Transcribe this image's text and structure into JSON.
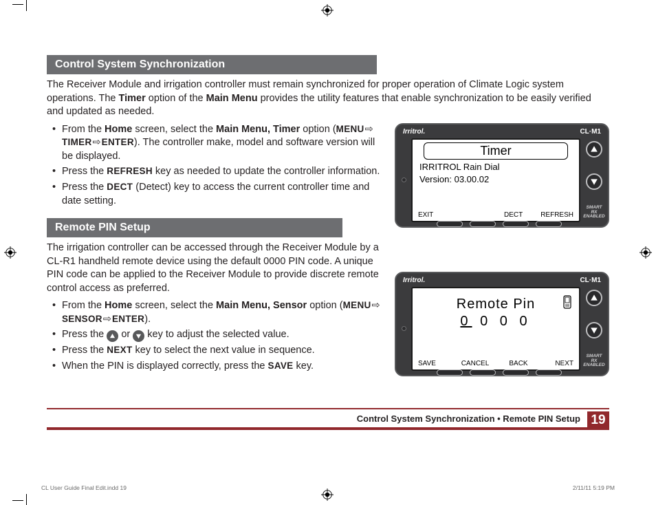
{
  "section1": {
    "title": "Control System Synchronization",
    "intro_parts": [
      "The Receiver Module and irrigation controller must remain synchronized for proper operation of Climate Logic system operations. The ",
      "Timer",
      " option of the ",
      "Main Menu",
      " provides the utility features that enable synchronization to be easily verified and updated as needed."
    ],
    "bullets": [
      {
        "pre": "From the ",
        "b1": "Home",
        "mid1": " screen, select the ",
        "b2": "Main Menu, Timer",
        "mid2": " option (",
        "path1": "MENU",
        "path2": "TIMER",
        "path3": "ENTER",
        "post": "). The controller make, model and software version will be displayed."
      },
      {
        "pre": "Press the ",
        "sc": "REFRESH",
        "post": " key as needed to update the controller information."
      },
      {
        "pre": "Press the ",
        "sc": "DECT",
        "mid": " (Detect) key to access the current controller time and date setting.",
        "post": ""
      }
    ]
  },
  "section2": {
    "title": "Remote PIN Setup",
    "intro": "The irrigation controller can be accessed through the Receiver Module by a CL-R1 handheld remote device using the default 0000 PIN code. A unique PIN code can be applied to the Receiver Module to provide discrete remote control access as preferred.",
    "bullets": [
      {
        "pre": "From the ",
        "b1": "Home",
        "mid1": " screen, select the ",
        "b2": "Main Menu, Sensor",
        "mid2": " option (",
        "path1": "MENU",
        "path2": "SENSOR",
        "path3": "ENTER",
        "post": ")."
      },
      {
        "text_pre": " Press the ",
        "text_mid": " or ",
        "text_post": " key to adjust the selected value."
      },
      {
        "pre": " Press the ",
        "sc": "NEXT",
        "post": " key to select the next value in sequence."
      },
      {
        "pre": " When the PIN is displayed correctly, press the ",
        "sc": "SAVE",
        "post": " key."
      }
    ]
  },
  "device1": {
    "brand": "Irritrol.",
    "model": "CL·M1",
    "title": "Timer",
    "line1": "IRRITROL Rain Dial",
    "line2": "Version: 03.00.02",
    "soft": [
      "EXIT",
      "",
      "DECT",
      "REFRESH"
    ],
    "smartrx": [
      "SMART RX",
      "ENABLED"
    ]
  },
  "device2": {
    "brand": "Irritrol.",
    "model": "CL·M1",
    "title": "Remote Pin",
    "pin": [
      "0",
      "0",
      "0",
      "0"
    ],
    "soft": [
      "SAVE",
      "CANCEL",
      "BACK",
      "NEXT"
    ],
    "smartrx": [
      "SMART RX",
      "ENABLED"
    ]
  },
  "footer": {
    "title": "Control System Synchronization • Remote PIN Setup",
    "page": "19"
  },
  "indd": {
    "left": "CL User Guide Final Edit.indd   19",
    "right": "2/11/11   5:19 PM"
  }
}
